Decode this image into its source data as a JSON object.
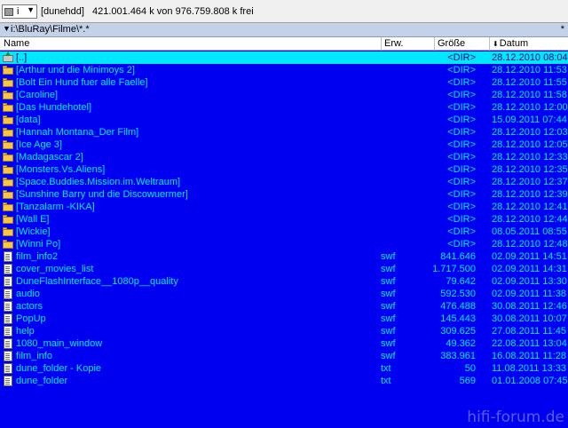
{
  "drive": {
    "letter": "i",
    "name": "[dunehdd]",
    "space_text": "421.001.464 k von 976.759.808 k frei"
  },
  "path": {
    "text": "i:\\BluRay\\Filme\\*.*",
    "star": "*"
  },
  "columns": {
    "name": "Name",
    "ext": "Erw.",
    "size": "Größe",
    "date": "Datum"
  },
  "files": [
    {
      "icon": "up-folder-icon",
      "name": "[..]",
      "ext": "",
      "size": "<DIR>",
      "date": "28.12.2010 08:04",
      "cursor": true
    },
    {
      "icon": "folder-icon",
      "name": "[Arthur und die Minimoys 2]",
      "ext": "",
      "size": "<DIR>",
      "date": "28.12.2010 11:53"
    },
    {
      "icon": "folder-icon",
      "name": "[Bolt Ein Hund fuer alle Faelle]",
      "ext": "",
      "size": "<DIR>",
      "date": "28.12.2010 11:55"
    },
    {
      "icon": "folder-icon",
      "name": "[Caroline]",
      "ext": "",
      "size": "<DIR>",
      "date": "28.12.2010 11:58"
    },
    {
      "icon": "folder-icon",
      "name": "[Das Hundehotel]",
      "ext": "",
      "size": "<DIR>",
      "date": "28.12.2010 12:00"
    },
    {
      "icon": "folder-icon",
      "name": "[data]",
      "ext": "",
      "size": "<DIR>",
      "date": "15.09.2011 07:44"
    },
    {
      "icon": "folder-icon",
      "name": "[Hannah Montana_Der Film]",
      "ext": "",
      "size": "<DIR>",
      "date": "28.12.2010 12:03"
    },
    {
      "icon": "folder-icon",
      "name": "[Ice Age 3]",
      "ext": "",
      "size": "<DIR>",
      "date": "28.12.2010 12:05"
    },
    {
      "icon": "folder-icon",
      "name": "[Madagascar 2]",
      "ext": "",
      "size": "<DIR>",
      "date": "28.12.2010 12:33"
    },
    {
      "icon": "folder-icon",
      "name": "[Monsters.Vs.Aliens]",
      "ext": "",
      "size": "<DIR>",
      "date": "28.12.2010 12:35"
    },
    {
      "icon": "folder-icon",
      "name": "[Space.Buddies.Mission.im.Weltraum]",
      "ext": "",
      "size": "<DIR>",
      "date": "28.12.2010 12:37"
    },
    {
      "icon": "folder-icon",
      "name": "[Sunshine Barry und die Discowuermer]",
      "ext": "",
      "size": "<DIR>",
      "date": "28.12.2010 12:39"
    },
    {
      "icon": "folder-icon",
      "name": "[Tanzalarm -KIKA]",
      "ext": "",
      "size": "<DIR>",
      "date": "28.12.2010 12:41"
    },
    {
      "icon": "folder-icon",
      "name": "[Wall E]",
      "ext": "",
      "size": "<DIR>",
      "date": "28.12.2010 12:44"
    },
    {
      "icon": "folder-icon",
      "name": "[Wickie]",
      "ext": "",
      "size": "<DIR>",
      "date": "08.05.2011 08:55"
    },
    {
      "icon": "folder-icon",
      "name": "[Winni Po]",
      "ext": "",
      "size": "<DIR>",
      "date": "28.12.2010 12:48"
    },
    {
      "icon": "file-icon",
      "name": "film_info2",
      "ext": "swf",
      "size": "841.646",
      "date": "02.09.2011 14:51"
    },
    {
      "icon": "file-icon",
      "name": "cover_movies_list",
      "ext": "swf",
      "size": "1.717.500",
      "date": "02.09.2011 14:31"
    },
    {
      "icon": "file-icon",
      "name": "DuneFlashInterface__1080p__quality",
      "ext": "swf",
      "size": "79.642",
      "date": "02.09.2011 13:30"
    },
    {
      "icon": "file-icon",
      "name": "audio",
      "ext": "swf",
      "size": "592.530",
      "date": "02.09.2011 11:38"
    },
    {
      "icon": "file-icon",
      "name": "actors",
      "ext": "swf",
      "size": "476.488",
      "date": "30.08.2011 12:46"
    },
    {
      "icon": "file-icon",
      "name": "PopUp",
      "ext": "swf",
      "size": "145.443",
      "date": "30.08.2011 10:07"
    },
    {
      "icon": "file-icon",
      "name": "help",
      "ext": "swf",
      "size": "309.625",
      "date": "27.08.2011 11:45"
    },
    {
      "icon": "file-icon",
      "name": "1080_main_window",
      "ext": "swf",
      "size": "49.362",
      "date": "22.08.2011 13:04"
    },
    {
      "icon": "file-icon",
      "name": "film_info",
      "ext": "swf",
      "size": "383.961",
      "date": "16.08.2011 11:28"
    },
    {
      "icon": "file-icon",
      "name": "dune_folder - Kopie",
      "ext": "txt",
      "size": "50",
      "date": "11.08.2011 13:33"
    },
    {
      "icon": "file-icon",
      "name": "dune_folder",
      "ext": "txt",
      "size": "569",
      "date": "01.01.2008 07:45"
    }
  ],
  "watermark": "hifi-forum.de",
  "colors": {
    "list_background": "#0000f0",
    "list_text": "#00e8ff",
    "cursor_background": "#00e8ff",
    "cursor_text": "#000080"
  }
}
